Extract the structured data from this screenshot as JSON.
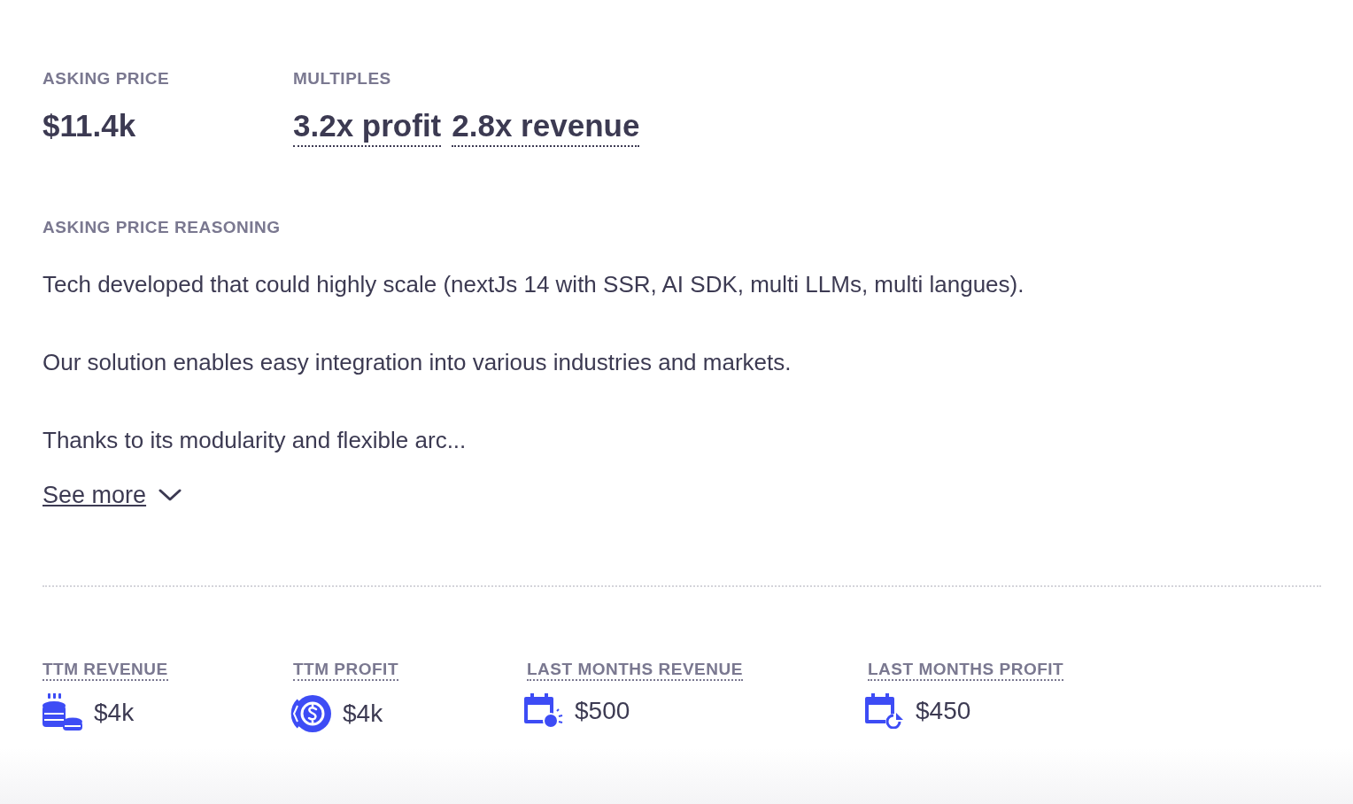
{
  "asking_price": {
    "label": "ASKING PRICE",
    "value": "$11.4k"
  },
  "multiples": {
    "label": "MULTIPLES",
    "items": [
      "3.2x profit",
      "2.8x revenue"
    ]
  },
  "reasoning": {
    "label": "ASKING PRICE REASONING",
    "paragraphs": [
      "Tech developed that could highly scale (nextJs 14 with SSR, AI SDK, multi LLMs, multi langues).",
      "Our solution enables easy integration into various industries and markets.",
      "Thanks to its modularity and flexible arc..."
    ],
    "see_more": "See more"
  },
  "metrics": [
    {
      "kind": "coins",
      "label": "TTM REVENUE",
      "value": "$4k"
    },
    {
      "kind": "dollar-cycle",
      "label": "TTM PROFIT",
      "value": "$4k"
    },
    {
      "kind": "calendar-sun",
      "label": "LAST MONTHS REVENUE",
      "value": "$500"
    },
    {
      "kind": "calendar-pie",
      "label": "LAST MONTHS PROFIT",
      "value": "$450"
    }
  ]
}
